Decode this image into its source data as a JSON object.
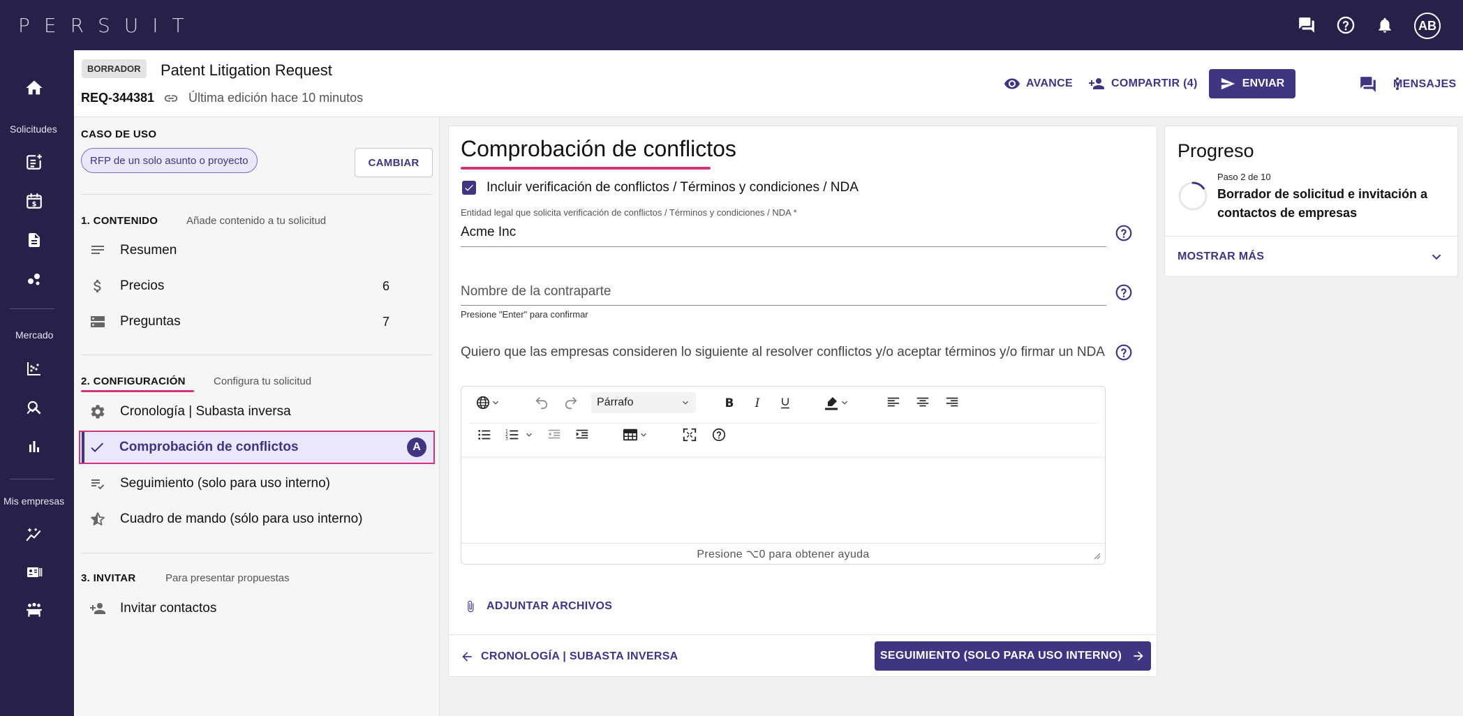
{
  "app": {
    "logo": "PERSUIT",
    "avatar_initials": "AB"
  },
  "leftnav": {
    "solicitudes_label": "Solicitudes",
    "mercado_label": "Mercado",
    "mis_empresas_label": "Mis empresas"
  },
  "header": {
    "status_badge": "BORRADOR",
    "title": "Patent Litigation Request",
    "request_id": "REQ-344381",
    "last_edit": "Última edición hace 10 minutos",
    "preview_label": "AVANCE",
    "share_label": "COMPARTIR (4)",
    "send_label": "ENVIAR",
    "messages_label": "MENSAJES"
  },
  "leftpanel": {
    "use_case_heading": "CASO DE USO",
    "use_case_chip": "RFP de un solo asunto o proyecto",
    "change_button": "CAMBIAR",
    "section1": {
      "title": "1. CONTENIDO",
      "subtitle": "Añade contenido a tu solicitud",
      "items": [
        {
          "label": "Resumen",
          "count": ""
        },
        {
          "label": "Precios",
          "count": "6"
        },
        {
          "label": "Preguntas",
          "count": "7"
        }
      ]
    },
    "section2": {
      "title": "2. CONFIGURACIÓN",
      "subtitle": "Configura tu solicitud",
      "items": [
        {
          "label": "Cronología | Subasta inversa"
        },
        {
          "label": "Comprobación de conflictos",
          "badge": "A"
        },
        {
          "label": "Seguimiento (solo para uso interno)"
        },
        {
          "label": "Cuadro de mando (sólo para uso interno)"
        }
      ]
    },
    "section3": {
      "title": "3. INVITAR",
      "subtitle": "Para presentar propuestas",
      "items": [
        {
          "label": "Invitar contactos"
        }
      ]
    }
  },
  "main": {
    "title": "Comprobación de conflictos",
    "checkbox_label": "Incluir verificación de conflictos / Términos y condiciones / NDA",
    "checkbox_checked": true,
    "entity_label": "Entidad legal que solicita verificación de conflictos / Términos y condiciones / NDA  *",
    "entity_value": "Acme Inc",
    "counterparty_placeholder": "Nombre de la contraparte",
    "counterparty_hint": "Presione \"Enter\" para confirmar",
    "considerations_label": "Quiero que las empresas consideren lo siguiente al resolver conflictos y/o aceptar términos y/o firmar un NDA",
    "editor": {
      "block_format": "Párrafo",
      "footer_hint": "Presione ⌥0 para obtener ayuda"
    },
    "attach_label": "ADJUNTAR ARCHIVOS",
    "back_label": "CRONOLOGÍA | SUBASTA INVERSA",
    "next_label": "SEGUIMIENTO (SOLO PARA USO INTERNO)"
  },
  "progress": {
    "title": "Progreso",
    "step": "Paso 2 de 10",
    "step_name": "Borrador de solicitud e invitación a contactos de empresas",
    "show_more": "MOSTRAR MÁS"
  },
  "colors": {
    "nav_bg": "#27214a",
    "accent": "#3f3580",
    "highlight": "#d0357a",
    "active_bg": "#ebe7fb"
  }
}
